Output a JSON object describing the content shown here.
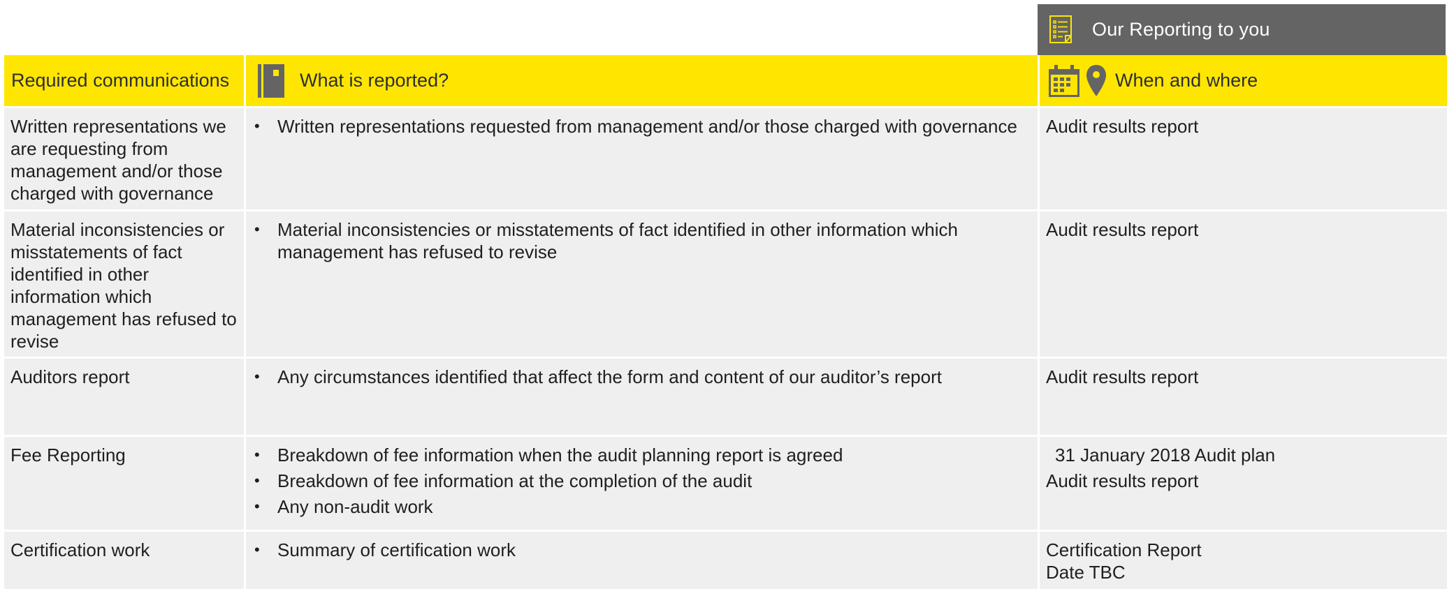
{
  "header_tab": {
    "label": "Our Reporting to you",
    "icon": "report-list-icon"
  },
  "columns": {
    "required": "Required communications",
    "what": "What is reported?",
    "when": "When and where"
  },
  "rows": [
    {
      "required": "Written representations we are requesting from management and/or those charged with governance",
      "what": [
        "Written representations requested from management and/or those charged with governance"
      ],
      "when": [
        "Audit results report"
      ]
    },
    {
      "required": "Material inconsistencies or misstatements of fact identified in other information which management has refused to revise",
      "what": [
        "Material inconsistencies or misstatements of fact identified in other information which management has refused to revise"
      ],
      "when": [
        "Audit results report"
      ]
    },
    {
      "required": "Auditors report",
      "what": [
        "Any circumstances identified that affect the form and content of our auditor’s report"
      ],
      "when": [
        "Audit results report"
      ]
    },
    {
      "required": "Fee Reporting",
      "what": [
        "Breakdown of fee information when the  audit planning report is agreed",
        "Breakdown of fee information at the completion of the audit",
        "Any non-audit work"
      ],
      "when": [
        "31 January 2018 Audit plan",
        "Audit results report"
      ]
    },
    {
      "required": "Certification work",
      "what": [
        "Summary of certification work"
      ],
      "when": [
        "Certification Report",
        "Date TBC"
      ]
    }
  ],
  "colors": {
    "header_yellow": "#ffe600",
    "tab_grey": "#646464",
    "cell_grey": "#efefef",
    "icon_grey": "#646464",
    "tab_icon_yellow": "#ffe600"
  }
}
